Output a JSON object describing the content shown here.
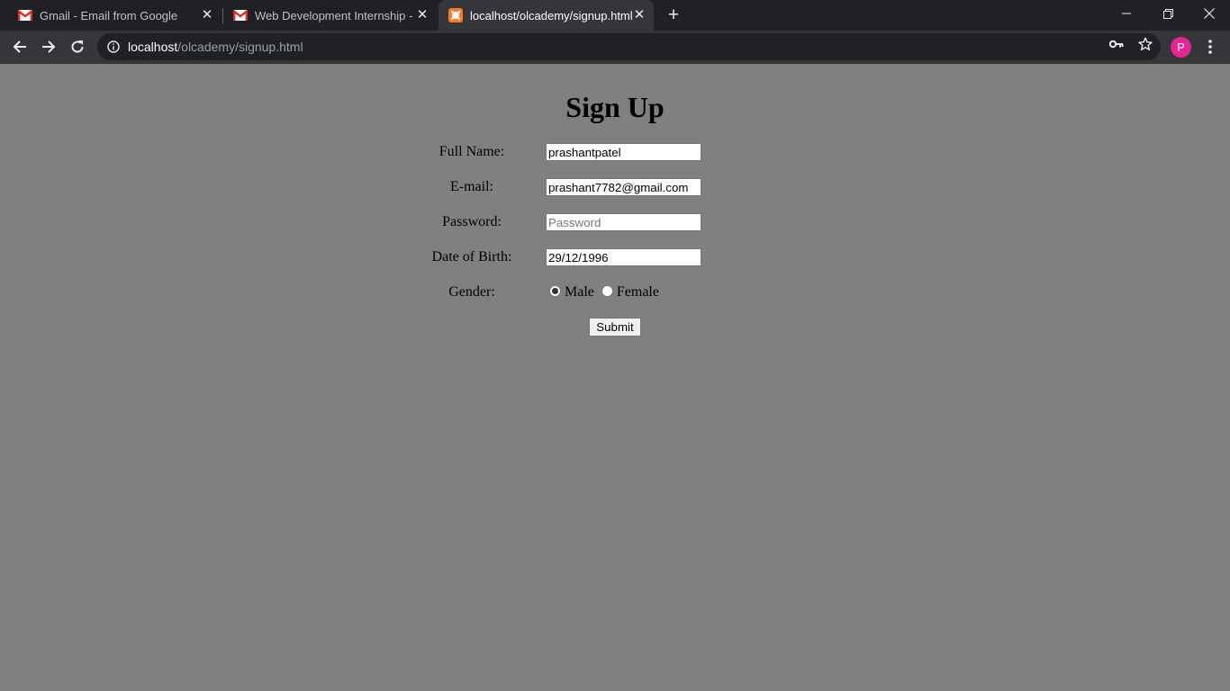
{
  "browser": {
    "tabs": [
      {
        "title": "Gmail - Email from Google",
        "icon": "gmail-icon",
        "active": false
      },
      {
        "title": "Web Development Internship - p",
        "icon": "gmail-icon",
        "active": false
      },
      {
        "title": "localhost/olcademy/signup.html",
        "icon": "xampp-icon",
        "active": true
      }
    ],
    "url": {
      "host": "localhost",
      "path": "/olcademy/signup.html"
    },
    "profile_initial": "P",
    "colors": {
      "tabstrip": "#202124",
      "toolbar": "#35363a",
      "avatar": "#e52592",
      "page_bg": "#808080"
    }
  },
  "form": {
    "title": "Sign Up",
    "full_name": {
      "label": "Full Name:",
      "value": "prashantpatel"
    },
    "email": {
      "label": "E-mail:",
      "value": "prashant7782@gmail.com"
    },
    "password": {
      "label": "Password:",
      "value": "",
      "placeholder": "Password"
    },
    "dob": {
      "label": "Date of Birth:",
      "value": "29/12/1996"
    },
    "gender": {
      "label": "Gender:",
      "options": [
        "Male",
        "Female"
      ],
      "selected": "Male"
    },
    "submit_label": "Submit"
  }
}
